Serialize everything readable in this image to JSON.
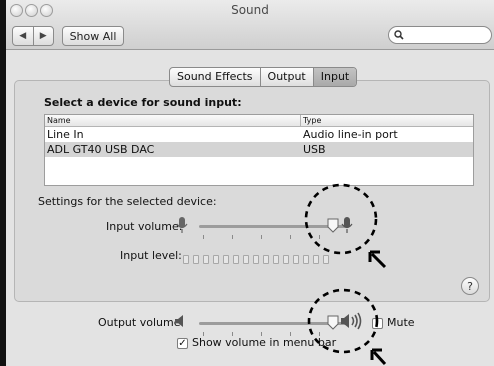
{
  "window": {
    "title": "Sound",
    "nav": {
      "back_icon": "back-arrow-icon",
      "forward_icon": "forward-arrow-icon"
    },
    "show_all_label": "Show All",
    "search": {
      "placeholder": "",
      "icon": "search-icon"
    }
  },
  "tabs": [
    {
      "label": "Sound Effects",
      "selected": false
    },
    {
      "label": "Output",
      "selected": false
    },
    {
      "label": "Input",
      "selected": true
    }
  ],
  "input_pane": {
    "heading": "Select a device for sound input:",
    "columns": [
      "Name",
      "Type"
    ],
    "devices": [
      {
        "name": "Line In",
        "type": "Audio line-in port",
        "selected": false
      },
      {
        "name": "ADL GT40 USB DAC",
        "type": "USB",
        "selected": true
      }
    ],
    "settings_heading": "Settings for the selected device:",
    "input_volume": {
      "label": "Input volume:",
      "value": 0.95,
      "min_icon": "microphone-low-icon",
      "max_icon": "microphone-high-icon"
    },
    "input_level": {
      "label": "Input level:",
      "segments": 15,
      "active": 0
    }
  },
  "output": {
    "label": "Output volume:",
    "value": 0.95,
    "min_icon": "speaker-low-icon",
    "max_icon": "speaker-high-icon",
    "mute": {
      "label": "Mute",
      "checked": false
    },
    "show_in_menubar": {
      "label": "Show volume in menu bar",
      "checked": true
    }
  },
  "help_label": "?",
  "annotations": {
    "color": "#000000",
    "highlight_icon": "dashed-circle-icon",
    "pointer_icon": "arrow-pointer-icon"
  }
}
